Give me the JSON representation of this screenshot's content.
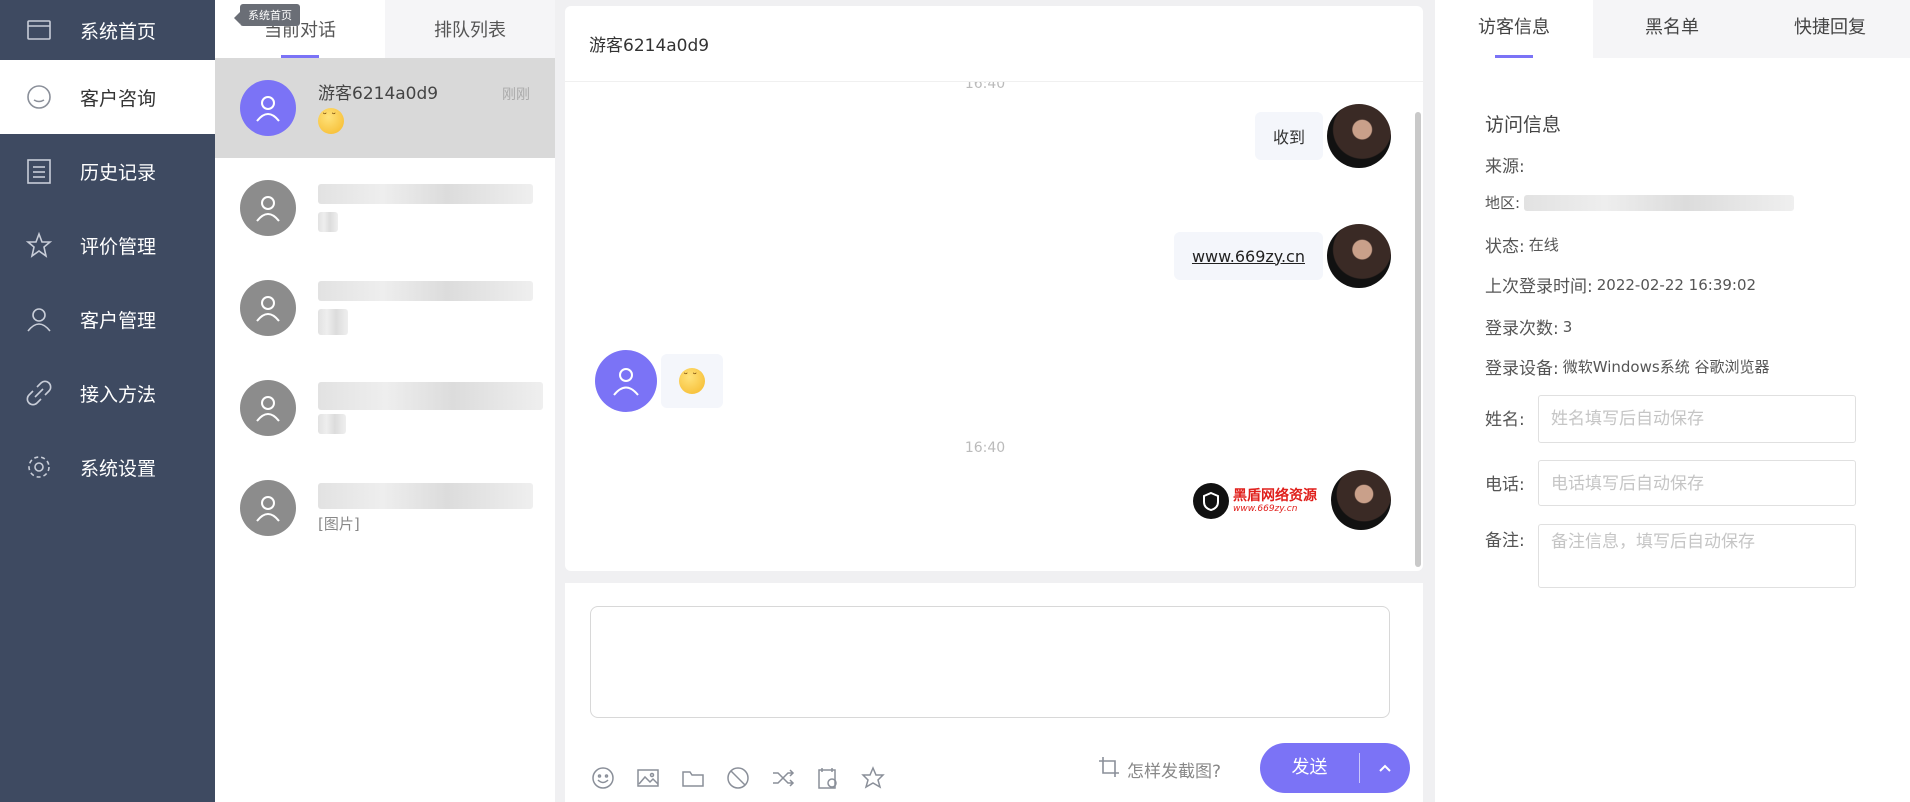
{
  "sidebar": {
    "items": [
      {
        "label": "系统首页",
        "icon": "window-icon"
      },
      {
        "label": "客户咨询",
        "icon": "chat-bubble-icon"
      },
      {
        "label": "历史记录",
        "icon": "list-icon"
      },
      {
        "label": "评价管理",
        "icon": "star-icon"
      },
      {
        "label": "客户管理",
        "icon": "user-icon"
      },
      {
        "label": "接入方法",
        "icon": "link-icon"
      },
      {
        "label": "系统设置",
        "icon": "gear-icon"
      }
    ],
    "tooltip": "系统首页"
  },
  "conversations": {
    "tabs": [
      "当前对话",
      "排队列表"
    ],
    "items": [
      {
        "name": "游客6214a0d9",
        "time": "刚刚"
      },
      {
        "sub": "[图片]"
      }
    ]
  },
  "chat": {
    "title": "游客6214a0d9",
    "time_top": "16:40",
    "msg1": "收到",
    "msg2": "www.669zy.cn",
    "time_mid": "16:40",
    "logo_text": "黑盾网络资源",
    "logo_url": "www.669zy.cn"
  },
  "composer": {
    "crop_hint": "怎样发截图?",
    "send_label": "发送"
  },
  "right": {
    "tabs": [
      "访客信息",
      "黑名单",
      "快捷回复"
    ],
    "section_title": "访问信息",
    "source_label": "来源:",
    "region_label": "地区:",
    "status_label": "状态:",
    "status_value": "在线",
    "last_login_label": "上次登录时间:",
    "last_login_value": "2022-02-22 16:39:02",
    "login_count_label": "登录次数:",
    "login_count_value": "3",
    "device_label": "登录设备:",
    "device_value": "微软Windows系统 谷歌浏览器",
    "name_label": "姓名:",
    "name_placeholder": "姓名填写后自动保存",
    "phone_label": "电话:",
    "phone_placeholder": "电话填写后自动保存",
    "note_label": "备注:",
    "note_placeholder": "备注信息，填写后自动保存"
  },
  "colors": {
    "sidebar_bg": "#3e4a61",
    "accent": "#7b73f6"
  }
}
